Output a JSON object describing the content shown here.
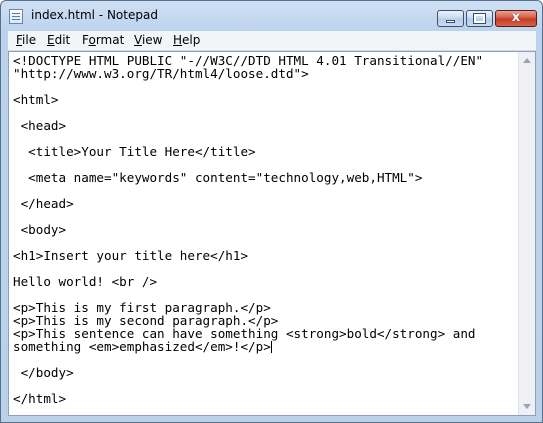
{
  "window": {
    "title": "index.html - Notepad"
  },
  "controls": {
    "close_glyph": "x"
  },
  "menu": {
    "items": [
      {
        "accel": "F",
        "rest": "ile"
      },
      {
        "accel": "E",
        "rest": "dit"
      },
      {
        "accel": "",
        "pre": "F",
        "acc2": "o",
        "rest": "rmat"
      },
      {
        "accel": "V",
        "rest": "iew"
      },
      {
        "accel": "H",
        "rest": "elp"
      }
    ]
  },
  "editor": {
    "lines": [
      "<!DOCTYPE HTML PUBLIC \"-//W3C//DTD HTML 4.01 Transitional//EN\"",
      "\"http://www.w3.org/TR/html4/loose.dtd\">",
      "",
      "<html>",
      "",
      " <head>",
      "",
      "  <title>Your Title Here</title>",
      "",
      "  <meta name=\"keywords\" content=\"technology,web,HTML\">",
      "",
      " </head>",
      "",
      " <body>",
      "",
      "<h1>Insert your title here</h1>",
      "",
      "Hello world! <br />",
      "",
      "<p>This is my first paragraph.</p>",
      "<p>This is my second paragraph.</p>",
      "<p>This sentence can have something <strong>bold</strong> and",
      "something <em>emphasized</em>!</p>",
      "",
      " </body>",
      "",
      "</html>"
    ]
  }
}
